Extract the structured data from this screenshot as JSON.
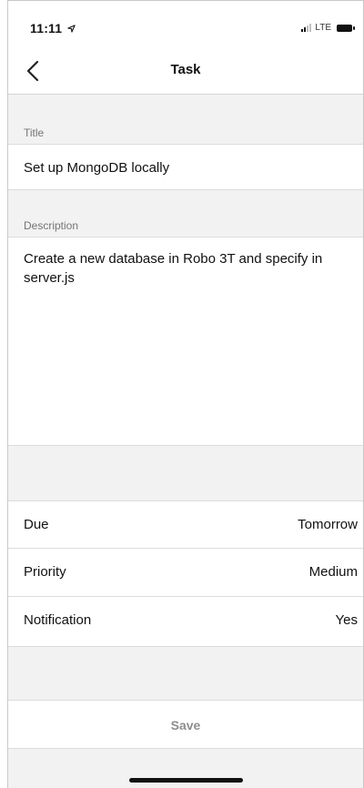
{
  "status_bar": {
    "time": "11:11",
    "location_icon": "location-arrow-icon",
    "network": "LTE",
    "signal_icon": "cellular-signal-icon",
    "battery_icon": "battery-icon"
  },
  "nav": {
    "title": "Task",
    "back_icon": "chevron-left-icon"
  },
  "form": {
    "title_label": "Title",
    "title_value": "Set up MongoDB locally",
    "description_label": "Description",
    "description_value": "Create a new database in Robo 3T and specify in server.js"
  },
  "settings": [
    {
      "label": "Due",
      "value": "Tomorrow"
    },
    {
      "label": "Priority",
      "value": "Medium"
    },
    {
      "label": "Notification",
      "value": "Yes"
    }
  ],
  "actions": {
    "save_label": "Save"
  }
}
